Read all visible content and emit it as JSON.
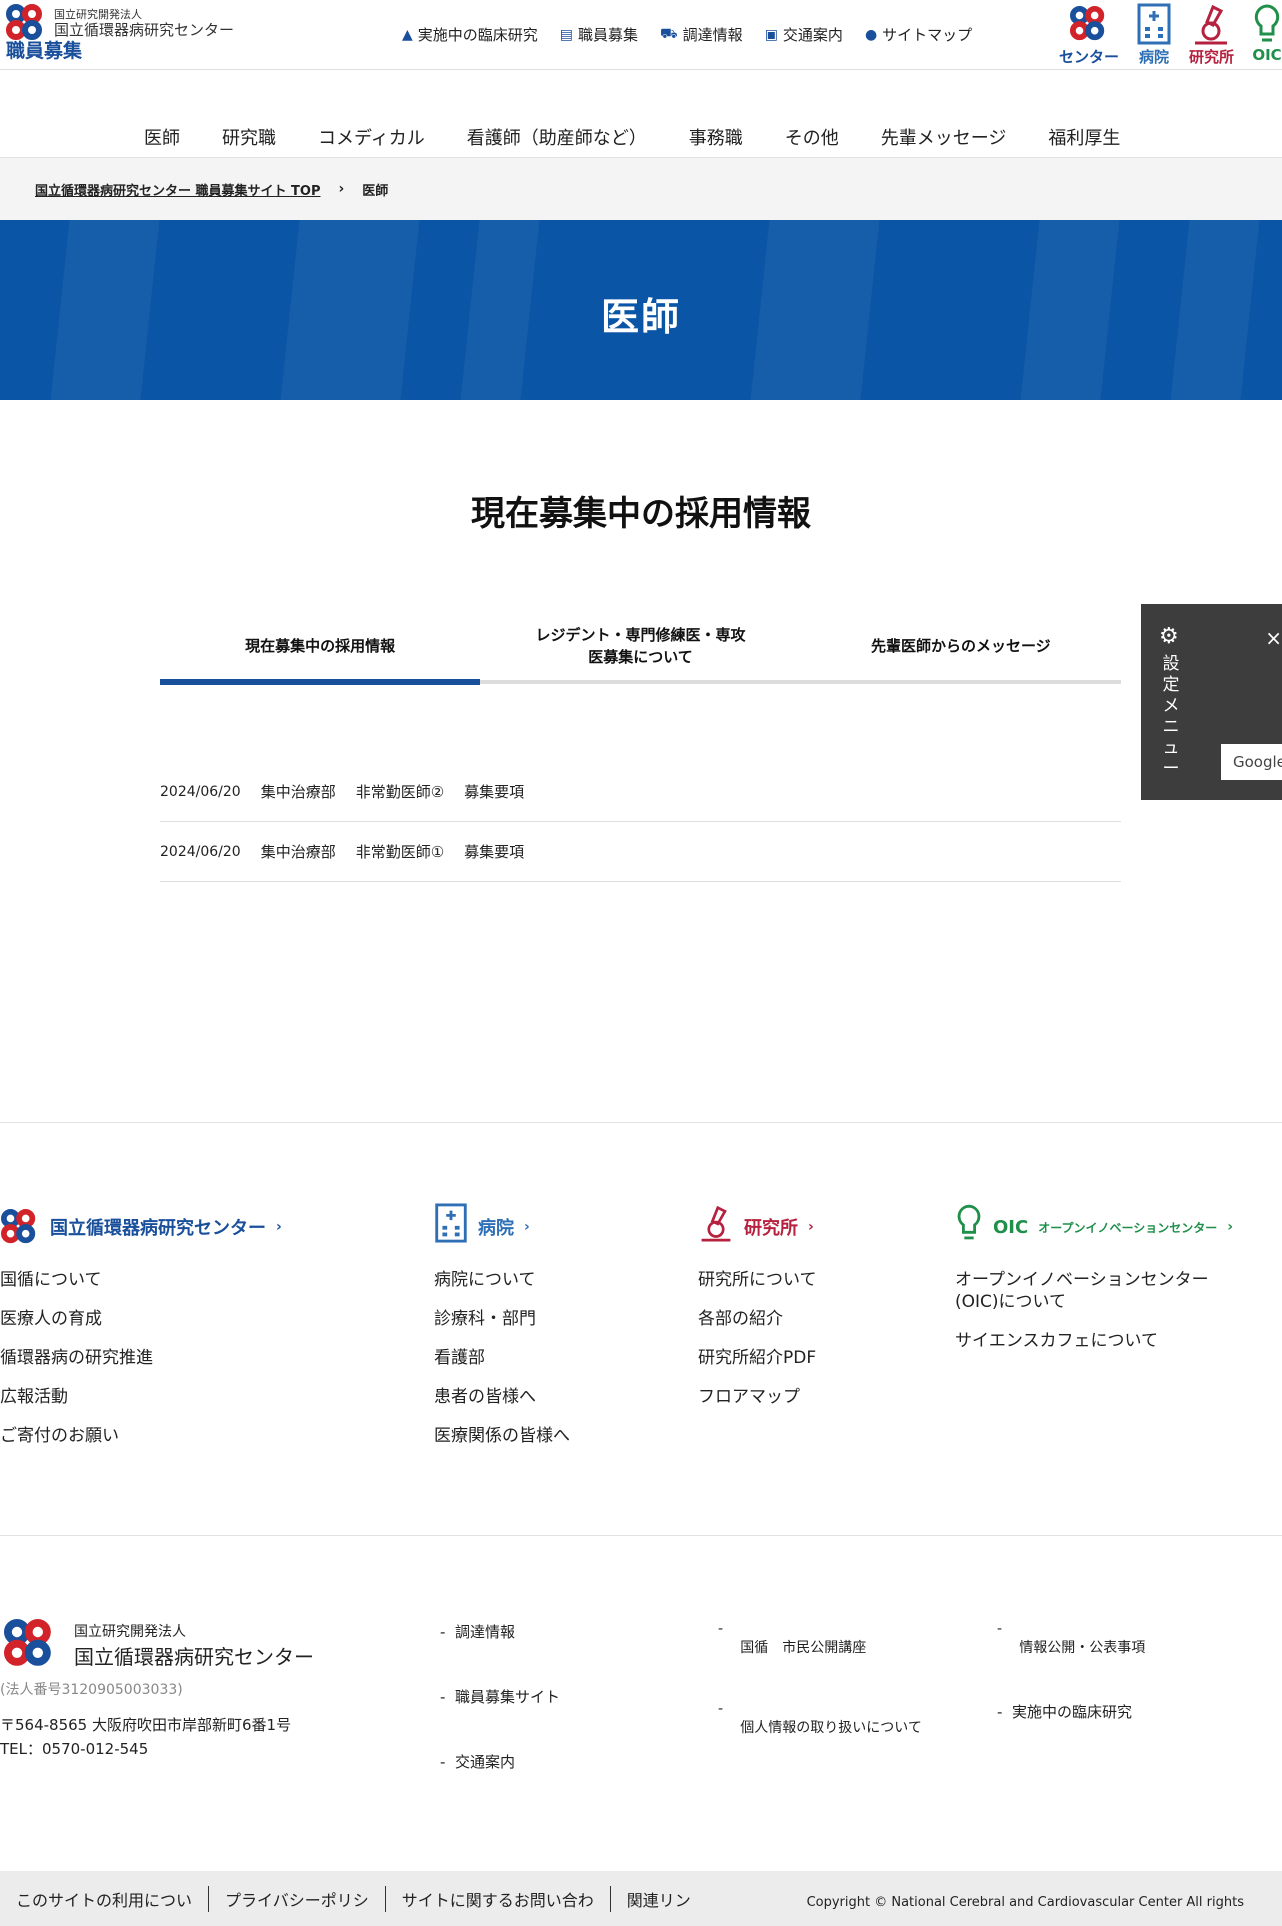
{
  "header": {
    "logo_small": "国立研究開発法人",
    "logo_name": "国立循環器病研究センター",
    "logo_sub": "職員募集",
    "utility": [
      {
        "label": "実施中の臨床研究",
        "icon": "flask-icon"
      },
      {
        "label": "職員募集",
        "icon": "document-icon"
      },
      {
        "label": "調達情報",
        "icon": "cart-icon"
      },
      {
        "label": "交通案内",
        "icon": "train-icon"
      },
      {
        "label": "サイトマップ",
        "icon": "pin-icon"
      }
    ],
    "brands": [
      {
        "label": "センター",
        "color": "#1a4f9c"
      },
      {
        "label": "病院",
        "color": "#2f6fb5"
      },
      {
        "label": "研究所",
        "color": "#b5213e"
      },
      {
        "label": "OIC",
        "color": "#1f8f4a"
      }
    ]
  },
  "nav": [
    "医師",
    "研究職",
    "コメディカル",
    "看護師（助産師など）",
    "事務職",
    "その他",
    "先輩メッセージ",
    "福利厚生"
  ],
  "breadcrumb": {
    "home": "国立循環器病研究センター 職員募集サイト TOP",
    "current": "医師"
  },
  "hero": {
    "title": "医師"
  },
  "section": {
    "title": "現在募集中の採用情報"
  },
  "tabs": [
    "現在募集中の採用情報",
    "レジデント・専門修練医・専攻医募集について",
    "先輩医師からのメッセージ"
  ],
  "jobs": [
    {
      "date": "2024/06/20",
      "dept": "集中治療部",
      "title": "非常勤医師②",
      "link": "募集要項"
    },
    {
      "date": "2024/06/20",
      "dept": "集中治療部",
      "title": "非常勤医師①",
      "link": "募集要項"
    }
  ],
  "settings": {
    "label": "設定メニュー",
    "close": "×",
    "google": "Google"
  },
  "sitemap": {
    "center": {
      "title": "国立循環器病研究センター",
      "items": [
        "国循について",
        "医療人の育成",
        "循環器病の研究推進",
        "広報活動",
        "ご寄付のお願い"
      ]
    },
    "hospital": {
      "title": "病院",
      "items": [
        "病院について",
        "診療科・部門",
        "看護部",
        "患者の皆様へ",
        "医療関係の皆様へ"
      ]
    },
    "institute": {
      "title": "研究所",
      "items": [
        "研究所について",
        "各部の紹介",
        "研究所紹介PDF",
        "フロアマップ"
      ]
    },
    "oic": {
      "title": "OIC",
      "subtitle": "オープンイノベーションセンター",
      "items": [
        "オープンイノベーションセンター(OIC)について",
        "サイエンスカフェについて"
      ]
    }
  },
  "footer": {
    "org_small": "国立研究開発法人",
    "org_name": "国立循環器病研究センター",
    "corp_no": "(法人番号3120905003033)",
    "address": "〒564-8565 大阪府吹田市岸部新町6番1号",
    "tel": "TEL：0570-012-545",
    "links_col1": [
      "調達情報",
      "職員募集サイト",
      "交通案内"
    ],
    "links_col2": [
      "国循　市民公開講座",
      "個人情報の取り扱いについて"
    ],
    "links_col3": [
      "情報公開・公表事項",
      "実施中の臨床研究"
    ]
  },
  "bottom": {
    "links": [
      "このサイトの利用につい",
      "プライバシーポリシ",
      "サイトに関するお問い合わ",
      "関連リン"
    ],
    "copyright": "Copyright © National Cerebral and Cardiovascular Center All rights"
  }
}
